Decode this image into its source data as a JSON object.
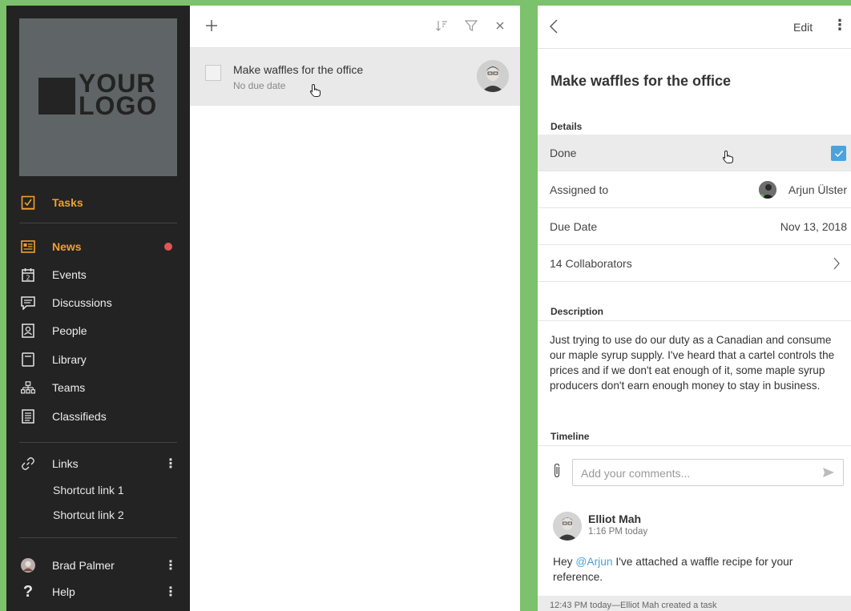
{
  "sidebar": {
    "logo_line1": "YOUR",
    "logo_line2": "LOGO",
    "items": [
      {
        "label": "Tasks",
        "icon": "tasks-icon"
      },
      {
        "label": "News",
        "icon": "news-icon"
      },
      {
        "label": "Events",
        "icon": "calendar-icon"
      },
      {
        "label": "Discussions",
        "icon": "discussions-icon"
      },
      {
        "label": "People",
        "icon": "people-icon"
      },
      {
        "label": "Library",
        "icon": "library-icon"
      },
      {
        "label": "Teams",
        "icon": "teams-icon"
      },
      {
        "label": "Classifieds",
        "icon": "classifieds-icon"
      }
    ],
    "links_label": "Links",
    "shortcuts": [
      "Shortcut link 1",
      "Shortcut link 2"
    ],
    "user_name": "Brad Palmer",
    "help_label": "Help",
    "calendar_day": "2",
    "accent_color": "#f0a030",
    "notification_color": "#e05555"
  },
  "list": {
    "task": {
      "title": "Make waffles for the office",
      "due": "No due date"
    }
  },
  "detail": {
    "edit_label": "Edit",
    "title": "Make waffles for the office",
    "details_label": "Details",
    "done_label": "Done",
    "assigned_label": "Assigned to",
    "assigned_value": "Arjun Ülster",
    "due_label": "Due Date",
    "due_value": "Nov 13, 2018",
    "collaborators_label": "14 Collaborators",
    "description_label": "Description",
    "description_text": "Just trying to use do our duty as a Canadian and consume our maple syrup supply. I've heard that a cartel controls the prices and if we don't eat enough of it, some maple syrup producers don't earn enough money to stay in business.",
    "timeline_label": "Timeline",
    "comment_placeholder": "Add your comments...",
    "comment": {
      "author": "Elliot Mah",
      "time": "1:16 PM today",
      "body_prefix": "Hey ",
      "mention": "@Arjun",
      "body_suffix": " I've attached a waffle recipe for your reference."
    },
    "footer_text": "12:43 PM today—Elliot Mah created a task",
    "checkbox_color": "#4aa3df"
  }
}
